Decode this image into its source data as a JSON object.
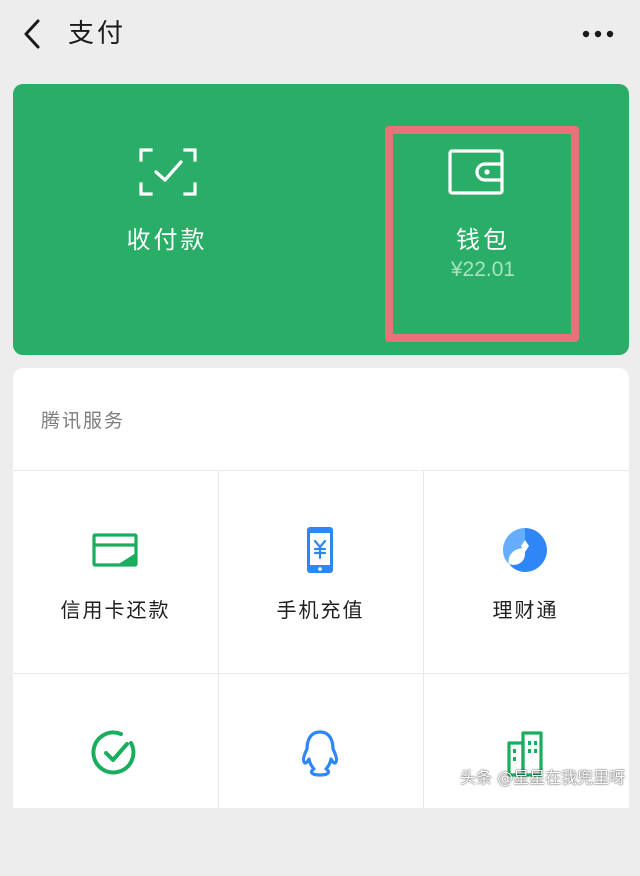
{
  "header": {
    "title": "支付"
  },
  "main_card": {
    "items": [
      {
        "label": "收付款",
        "icon": "scan-check-icon"
      },
      {
        "label": "钱包",
        "amount": "¥22.01",
        "icon": "wallet-icon"
      }
    ],
    "highlight_color": "#e8727a",
    "background_color": "#2aae67"
  },
  "services": {
    "section_title": "腾讯服务",
    "tiles": [
      {
        "label": "信用卡还款",
        "icon": "credit-card-icon",
        "color": "#1aad5e"
      },
      {
        "label": "手机充值",
        "icon": "mobile-topup-icon",
        "color": "#2f86f6"
      },
      {
        "label": "理财通",
        "icon": "wealth-icon",
        "color": "#2f86f6"
      },
      {
        "label": "",
        "icon": "checkmark-circle-icon",
        "color": "#1aad5e"
      },
      {
        "label": "",
        "icon": "qq-penguin-icon",
        "color": "#2f86f6"
      },
      {
        "label": "",
        "icon": "city-building-icon",
        "color": "#1aad5e"
      }
    ]
  },
  "watermark": "头条 @星星在我兜里呀"
}
